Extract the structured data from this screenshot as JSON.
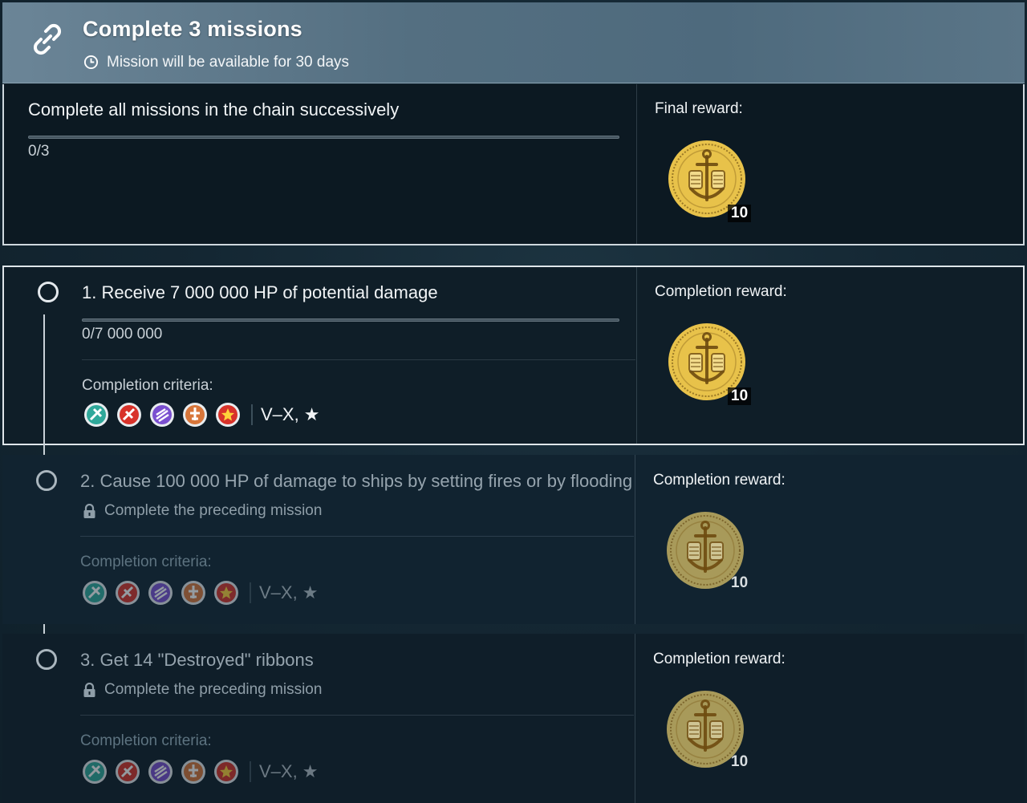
{
  "header": {
    "title": "Complete 3 missions",
    "availability": "Mission will be available for 30 days",
    "icon": "chain-link-icon"
  },
  "chain": {
    "description": "Complete all missions in the chain successively",
    "progress_text": "0/3",
    "progress_fraction": 0,
    "reward_label": "Final reward:",
    "reward_count": "10"
  },
  "missions": [
    {
      "title": "1. Receive 7 000 000 HP of potential damage",
      "progress_text": "0/7 000 000",
      "progress_fraction": 0,
      "criteria_label": "Completion criteria:",
      "tiers": "V–X, ★",
      "reward_label": "Completion reward:",
      "reward_count": "10",
      "locked": false
    },
    {
      "title": "2. Cause 100 000 HP of damage to ships by setting fires or by flooding",
      "lock_text": "Complete the preceding mission",
      "criteria_label": "Completion criteria:",
      "tiers": "V–X, ★",
      "reward_label": "Completion reward:",
      "reward_count": "10",
      "locked": true
    },
    {
      "title": "3. Get 14 \"Destroyed\" ribbons",
      "lock_text": "Complete the preceding mission",
      "criteria_label": "Completion criteria:",
      "tiers": "V–X, ★",
      "reward_label": "Completion reward:",
      "reward_count": "10",
      "locked": true
    }
  ],
  "ship_classes": [
    "destroyer-icon",
    "cruiser-icon",
    "battleship-icon",
    "aircraft-carrier-icon",
    "submarine-icon"
  ],
  "colors": {
    "header_bg": "#5a7587",
    "panel_bg": "#0f1e28",
    "coin_gold": "#e8c24a",
    "destroyer": "#2fa89a",
    "cruiser": "#d8322a",
    "battleship": "#7a4fd0",
    "carrier": "#d8763a",
    "submarine": "#d8322a"
  }
}
